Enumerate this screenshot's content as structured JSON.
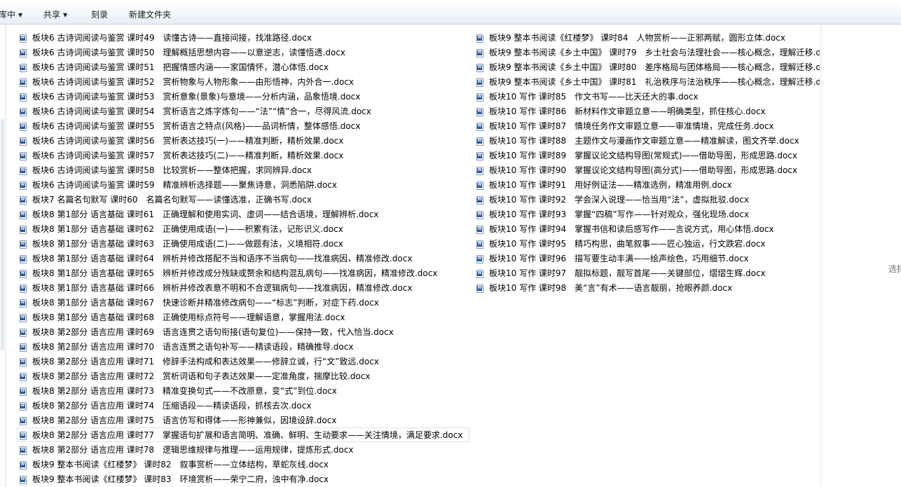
{
  "toolbar": {
    "organize_label": "库中",
    "share_label": "共享",
    "burn_label": "刻录",
    "new_folder_label": "新建文件夹"
  },
  "preview": {
    "hint": "选择"
  },
  "files_col1": [
    "板块6 古诗词阅读与鉴赏 课时49　读懂古诗——直接间接，找准路径.docx",
    "板块6 古诗词阅读与鉴赏 课时50　理解概括思想内容——以意逆志，读懂悟透.docx",
    "板块6 古诗词阅读与鉴赏 课时51　把握情感内涵——家国情怀，潜心体悟.docx",
    "板块6 古诗词阅读与鉴赏 课时52　赏析物象与人物形象——由形悟神，内外合一.docx",
    "板块6 古诗词阅读与鉴赏 课时53　赏析意象(景象)与意境——分析内涵，品象悟境.docx",
    "板块6 古诗词阅读与鉴赏 课时54　赏析语言之炼字炼句——“法”“情”合一，尽得风流.docx",
    "板块6 古诗词阅读与鉴赏 课时55　赏析语言之特点(风格)——品词析情，整体感悟.docx",
    "板块6 古诗词阅读与鉴赏 课时56　赏析表达技巧(一)——精准判断，精析效果.docx",
    "板块6 古诗词阅读与鉴赏 课时57　赏析表达技巧(二)——精准判断，精析效果.docx",
    "板块6 古诗词阅读与鉴赏 课时58　比较赏析——整体把握，求同辨异.docx",
    "板块6 古诗词阅读与鉴赏 课时59　精准辨析选择题——聚焦诗意，洞悉陷阱.docx",
    "板块7 名篇名句默写 课时60　名篇名句默写——读懂选准，正确书写.docx",
    "板块8 第1部分 语言基础 课时61　正确理解和使用实词、虚词——结合语境，理解辨析.docx",
    "板块8 第1部分 语言基础 课时62　正确使用成语(一)——积累有法，记形识义.docx",
    "板块8 第1部分 语言基础 课时63　正确使用成语(二)——做题有法，义境相符.docx",
    "板块8 第1部分 语言基础 课时64　辨析并修改搭配不当和语序不当病句——找准病因，精准修改.docx",
    "板块8 第1部分 语言基础 课时65　辨析并修改成分残缺或赘余和结构混乱病句——找准病因，精准修改.docx",
    "板块8 第1部分 语言基础 课时66　辨析并修改表意不明和不合逻辑病句——找准病因，精准修改.docx",
    "板块8 第1部分 语言基础 课时67　快速诊断并精准修改病句——“标志”判断，对症下药.docx",
    "板块8 第1部分 语言基础 课时68　正确使用标点符号——理解语意，掌握用法.docx",
    "板块8 第2部分 语言应用 课时69　语言连贯之语句衔接(语句复位)——保持一致，代入恰当.docx",
    "板块8 第2部分 语言应用 课时70　语言连贯之语句补写——精读语段，精确推导.docx",
    "板块8 第2部分 语言应用 课时71　修辞手法构成和表达效果——修辞立诚，行“文”致远.docx",
    "板块8 第2部分 语言应用 课时72　赏析词语和句子表达效果——定准角度，揣摩比较.docx",
    "板块8 第2部分 语言应用 课时73　精准变换句式——不改原意，变“式”到位.docx",
    "板块8 第2部分 语言应用 课时74　压缩语段——精读语段，抓核去次.docx",
    "板块8 第2部分 语言应用 课时75　语言仿写和得体——形神兼似，因境设辞.docx",
    "板块8 第2部分 语言应用 课时77　掌握语句扩展和语言简明、准确、鲜明、生动要求——关注情境，满足要求.docx",
    "板块8 第2部分 语言应用 课时78　逻辑思维规律与推理——运用规律，提炼形式.docx",
    "板块9 整本书阅读《红楼梦》 课时82　叙事赏析——立体结构，草蛇灰线.docx",
    "板块9 整本书阅读《红楼梦》 课时83　环境赏析——荣宁二府，浊中有净.docx"
  ],
  "files_col2": [
    "板块9 整本书阅读《红楼梦》 课时84　人物赏析——正邪两赋，圆形立体.docx",
    "板块9 整本书阅读《乡土中国》 课时79　乡土社会与法理社会——核心概念，理解迁移.d",
    "板块9 整本书阅读《乡土中国》 课时80　差序格局与团体格局——核心概念，理解迁移.d",
    "板块9 整本书阅读《乡土中国》 课时81　礼治秩序与法治秩序——核心概念，理解迁移.d",
    "板块10 写作 课时85　作文书写——比天还大的事.docx",
    "板块10 写作 课时86　新材料作文审题立意——明确类型，抓住核心.docx",
    "板块10 写作 课时87　情境任务作文审题立意——审准情境，完成任务.docx",
    "板块10 写作 课时88　主题作文与漫画作文审题立意——精准解读，图文齐举.docx",
    "板块10 写作 课时89　掌握议论文结构导图(常规式)——借助导图，形成思路.docx",
    "板块10 写作 课时90　掌握议论文结构导图(高分式)——借助导图，形成思路.docx",
    "板块10 写作 课时91　用好例证法——精准选例，精准用例.docx",
    "板块10 写作 课时92　学会深入说理——恰当用“法”，虚拟批驳.docx",
    "板块10 写作 课时93　掌握“四稿”写作——针对观众，强化现场.docx",
    "板块10 写作 课时94　掌握书信和读后感写作——言说方式，用心体悟.docx",
    "板块10 写作 课时95　精巧构思，曲笔叙事——匠心独运，行文跌宕.docx",
    "板块10 写作 课时96　描写要生动丰满——绘声绘色，巧用细节.docx",
    "板块10 写作 课时97　靓拟标题，靓写首尾——关键部位，熠熠生辉.docx",
    "板块10 写作 课时98　美“言”有术——语言靓丽，抢眼养颜.docx"
  ],
  "selected_index_col1": 27
}
